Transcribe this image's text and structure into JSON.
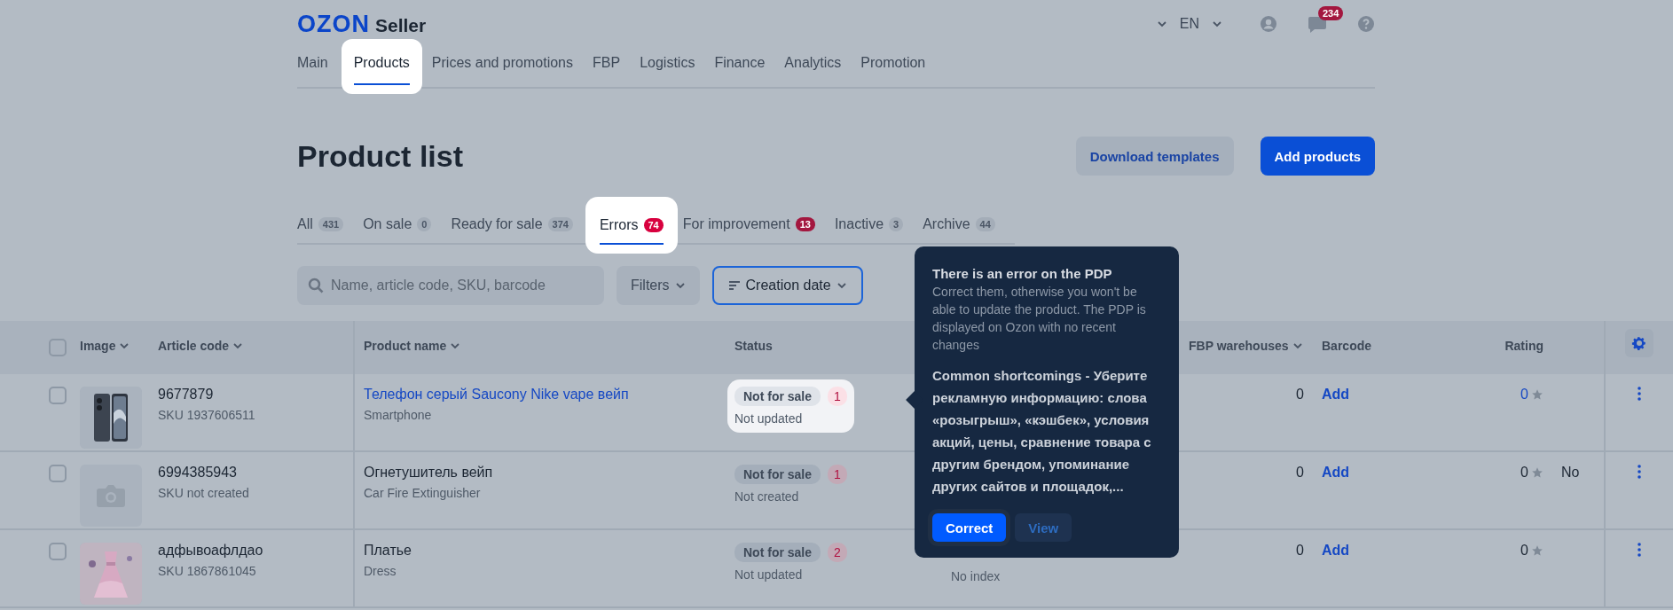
{
  "header": {
    "logo": {
      "brand": "OZON",
      "product": "Seller"
    },
    "language": "EN",
    "notifications": "234",
    "nav": [
      {
        "label": "Main",
        "selected": false
      },
      {
        "label": "Products",
        "selected": true
      },
      {
        "label": "Prices and promotions",
        "selected": false
      },
      {
        "label": "FBP",
        "selected": false
      },
      {
        "label": "Logistics",
        "selected": false
      },
      {
        "label": "Finance",
        "selected": false
      },
      {
        "label": "Analytics",
        "selected": false
      },
      {
        "label": "Promotion",
        "selected": false
      }
    ]
  },
  "page": {
    "title": "Product list",
    "buttons": [
      {
        "label": "Download templates",
        "kind": "secondary"
      },
      {
        "label": "Add products",
        "kind": "primary"
      }
    ]
  },
  "tabs": [
    {
      "label": "All",
      "count": "431",
      "alert": false,
      "selected": false
    },
    {
      "label": "On sale",
      "count": "0",
      "alert": false,
      "selected": false
    },
    {
      "label": "Ready for sale",
      "count": "374",
      "alert": false,
      "selected": false
    },
    {
      "label": "Errors",
      "count": "74",
      "alert": true,
      "selected": true
    },
    {
      "label": "For improvement",
      "count": "13",
      "alert": true,
      "selected": false
    },
    {
      "label": "Inactive",
      "count": "3",
      "alert": false,
      "selected": false
    },
    {
      "label": "Archive",
      "count": "44",
      "alert": false,
      "selected": false
    }
  ],
  "toolbar": {
    "search": {
      "placeholder": "Name, article code, SKU, barcode"
    },
    "filters": "Filters",
    "sort": "Creation date"
  },
  "table": {
    "select_all": {
      "checked": false
    },
    "columns": [
      {
        "label": "Image",
        "sortable": true
      },
      {
        "label": "Article code",
        "sortable": true
      },
      {
        "label": "Product name",
        "sortable": true
      },
      {
        "label": "Status",
        "sortable": false
      },
      {
        "label": "FBP warehouses",
        "sortable": true
      },
      {
        "label": "Barcode",
        "sortable": false
      },
      {
        "label": "Rating",
        "sortable": false
      }
    ],
    "rows": [
      {
        "checked": false,
        "article": "9677879",
        "sku": "SKU 1937606511",
        "name": "Телефон серый Saucony Nike vape вейп",
        "name_link": true,
        "category": "Smartphone",
        "status": "Not for sale",
        "errors": "1",
        "status_note": "Not updated",
        "highlighted": true,
        "fbp": "0",
        "barcode": "Add",
        "rating": "0",
        "rating_link": true
      },
      {
        "checked": false,
        "thumbnail": {
          "kind": "placeholder"
        },
        "article": "6994385943",
        "sku": "SKU not created",
        "name": "Огнетушитель вейп",
        "name_link": false,
        "category": "Car Fire Extinguisher",
        "status": "Not for sale",
        "errors": "1",
        "status_note": "Not created",
        "highlighted": false,
        "fbp": "0",
        "barcode": "Add",
        "rating": "0",
        "rating_link": false,
        "extra": "No"
      },
      {
        "checked": false,
        "article": "адфывоафлдао",
        "sku": "SKU 1867861045",
        "name": "Платье",
        "name_link": false,
        "category": "Dress",
        "status": "Not for sale",
        "errors": "2",
        "status_note": "Not updated",
        "highlighted": false,
        "visibility": "No index",
        "fbp": "0",
        "barcode": "Add",
        "rating": "0",
        "rating_link": false
      }
    ]
  },
  "tooltip": {
    "title": "There is an error on the PDP",
    "description": "Correct them, otherwise you won't be able to update the product. The PDP is displayed on Ozon with no recent changes",
    "body": "Common shortcomings - Уберите рекламную информацию: слова «розыгрыш», «кэшбек», условия акций, цены, сравнение товара с другим брендом, упоминание других сайтов и площадок,...",
    "buttons": [
      {
        "label": "Correct",
        "kind": "primary"
      },
      {
        "label": "View",
        "kind": "secondary"
      }
    ]
  }
}
